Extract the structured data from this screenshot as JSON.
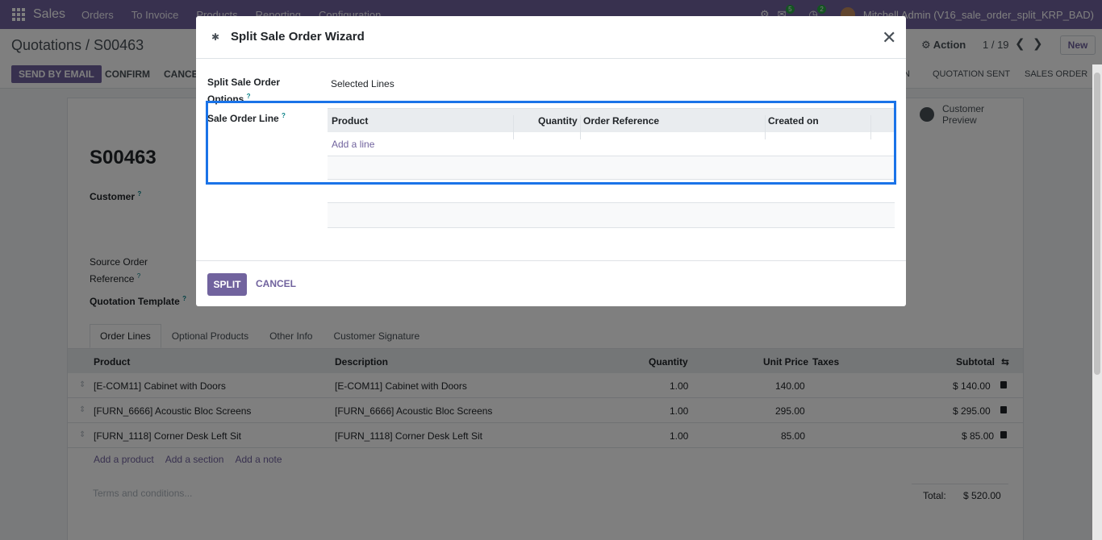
{
  "navbar": {
    "app_name": "Sales",
    "menus": [
      "Orders",
      "To Invoice",
      "Products",
      "Reporting",
      "Configuration"
    ],
    "messages_count": "5",
    "activities_count": "2",
    "user": "Mitchell Admin (V16_sale_order_split_KRP_BAD)"
  },
  "control_panel": {
    "breadcrumb": "Quotations / S00463",
    "action_label": "Action",
    "pager": "1 / 19",
    "new_label": "New",
    "send_email_label": "SEND BY EMAIL",
    "confirm_label": "CONFIRM",
    "cancel_label": "CANCEL",
    "status_current": "N",
    "status_steps": [
      "QUOTATION SENT",
      "SALES ORDER"
    ]
  },
  "form": {
    "preview_label": "Customer Preview",
    "order_name": "S00463",
    "customer_label": "Customer",
    "source_label": "Source Order Reference",
    "template_label": "Quotation Template",
    "tabs": [
      "Order Lines",
      "Optional Products",
      "Other Info",
      "Customer Signature"
    ],
    "columns": {
      "product": "Product",
      "description": "Description",
      "quantity": "Quantity",
      "unit_price": "Unit Price",
      "taxes": "Taxes",
      "subtotal": "Subtotal"
    },
    "lines": [
      {
        "product": "[E-COM11] Cabinet with Doors",
        "description": "[E-COM11] Cabinet with Doors",
        "quantity": "1.00",
        "unit_price": "140.00",
        "subtotal": "$ 140.00"
      },
      {
        "product": "[FURN_6666] Acoustic Bloc Screens",
        "description": "[FURN_6666] Acoustic Bloc Screens",
        "quantity": "1.00",
        "unit_price": "295.00",
        "subtotal": "$ 295.00"
      },
      {
        "product": "[FURN_1118] Corner Desk Left Sit",
        "description": "[FURN_1118] Corner Desk Left Sit",
        "quantity": "1.00",
        "unit_price": "85.00",
        "subtotal": "$ 85.00"
      }
    ],
    "add_product": "Add a product",
    "add_section": "Add a section",
    "add_note": "Add a note",
    "terms_placeholder": "Terms and conditions...",
    "total_label": "Total:",
    "total_value": "$ 520.00"
  },
  "modal": {
    "title": "Split Sale Order Wizard",
    "options_label": "Split Sale Order Options",
    "options_value": "Selected Lines",
    "lines_label": "Sale Order Line",
    "columns": {
      "product": "Product",
      "quantity": "Quantity",
      "order_ref": "Order Reference",
      "created_on": "Created on"
    },
    "add_line": "Add a line",
    "split_label": "SPLIT",
    "cancel_label": "CANCEL"
  },
  "colors": {
    "brand": "#71639e",
    "highlight": "#1a73e8"
  }
}
